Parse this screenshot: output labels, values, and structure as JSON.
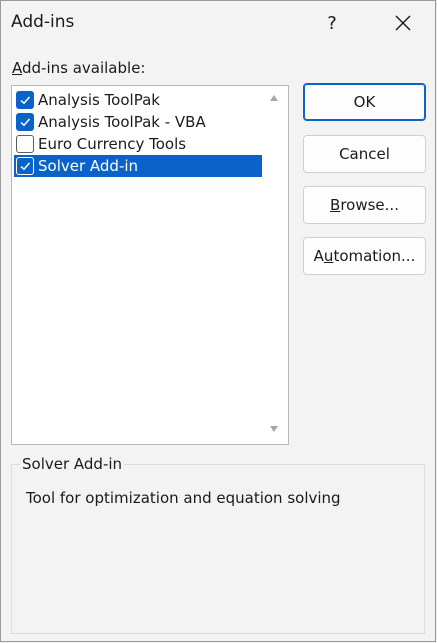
{
  "dialog": {
    "title": "Add-ins",
    "help_label": "?",
    "close_icon": "close-icon"
  },
  "list": {
    "label_prefix": "",
    "label_accel": "A",
    "label_rest": "dd-ins available:",
    "items": [
      {
        "label": "Analysis ToolPak",
        "checked": true,
        "selected": false
      },
      {
        "label": "Analysis ToolPak - VBA",
        "checked": true,
        "selected": false
      },
      {
        "label": "Euro Currency Tools",
        "checked": false,
        "selected": false
      },
      {
        "label": "Solver Add-in",
        "checked": true,
        "selected": true
      }
    ]
  },
  "buttons": {
    "ok": "OK",
    "cancel": "Cancel",
    "browse_accel": "B",
    "browse_rest": "rowse...",
    "automation_pre": "A",
    "automation_accel": "u",
    "automation_rest": "tomation..."
  },
  "description": {
    "title": "Solver Add-in",
    "text": "Tool for optimization and equation solving"
  },
  "colors": {
    "accent": "#0a63c9",
    "background": "#f3f3f3"
  }
}
